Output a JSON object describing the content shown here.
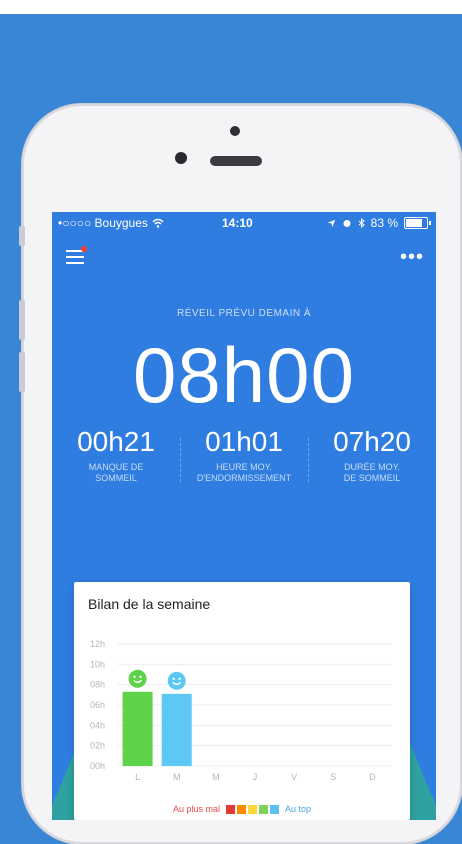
{
  "statusbar": {
    "carrier": "•○○○○ Bouygues",
    "time": "14:10",
    "battery": "83 %"
  },
  "header": {
    "menu_icon": "hamburger-icon",
    "more_icon": "more-dots-icon",
    "notification": true
  },
  "alarm": {
    "label": "RÉVEIL PRÉVU DEMAIN À",
    "time": "08h00"
  },
  "stats": [
    {
      "value": "00h21",
      "label_line1": "MANQUE DE",
      "label_line2": "SOMMEIL"
    },
    {
      "value": "01h01",
      "label_line1": "HEURE MOY.",
      "label_line2": "D'ENDORMISSEMENT"
    },
    {
      "value": "07h20",
      "label_line1": "DURÉE MOY.",
      "label_line2": "DE SOMMEIL"
    }
  ],
  "card": {
    "title": "Bilan de la semaine",
    "legend_worst": "Au plus mal",
    "legend_best": "Au top",
    "legend_colors": [
      "#e53935",
      "#fb8c00",
      "#fdd835",
      "#7cd35a",
      "#5bc0f2"
    ]
  },
  "chart_data": {
    "type": "bar",
    "categories": [
      "L",
      "M",
      "M",
      "J",
      "V",
      "S",
      "D"
    ],
    "values": [
      7.3,
      7.1,
      null,
      null,
      null,
      null,
      null
    ],
    "bar_colors": [
      "#5ed34a",
      "#5ec8f5",
      null,
      null,
      null,
      null,
      null
    ],
    "yticks": [
      "00h",
      "02h",
      "04h",
      "06h",
      "08h",
      "10h",
      "12h"
    ],
    "ylim": [
      0,
      12
    ],
    "mood_icons": [
      "smiley-icon",
      "smiley-icon"
    ]
  },
  "colors": {
    "app_blue": "#2f7de0",
    "background_blue": "#3a86d6",
    "mountain_teal": "#2ea2a0"
  }
}
